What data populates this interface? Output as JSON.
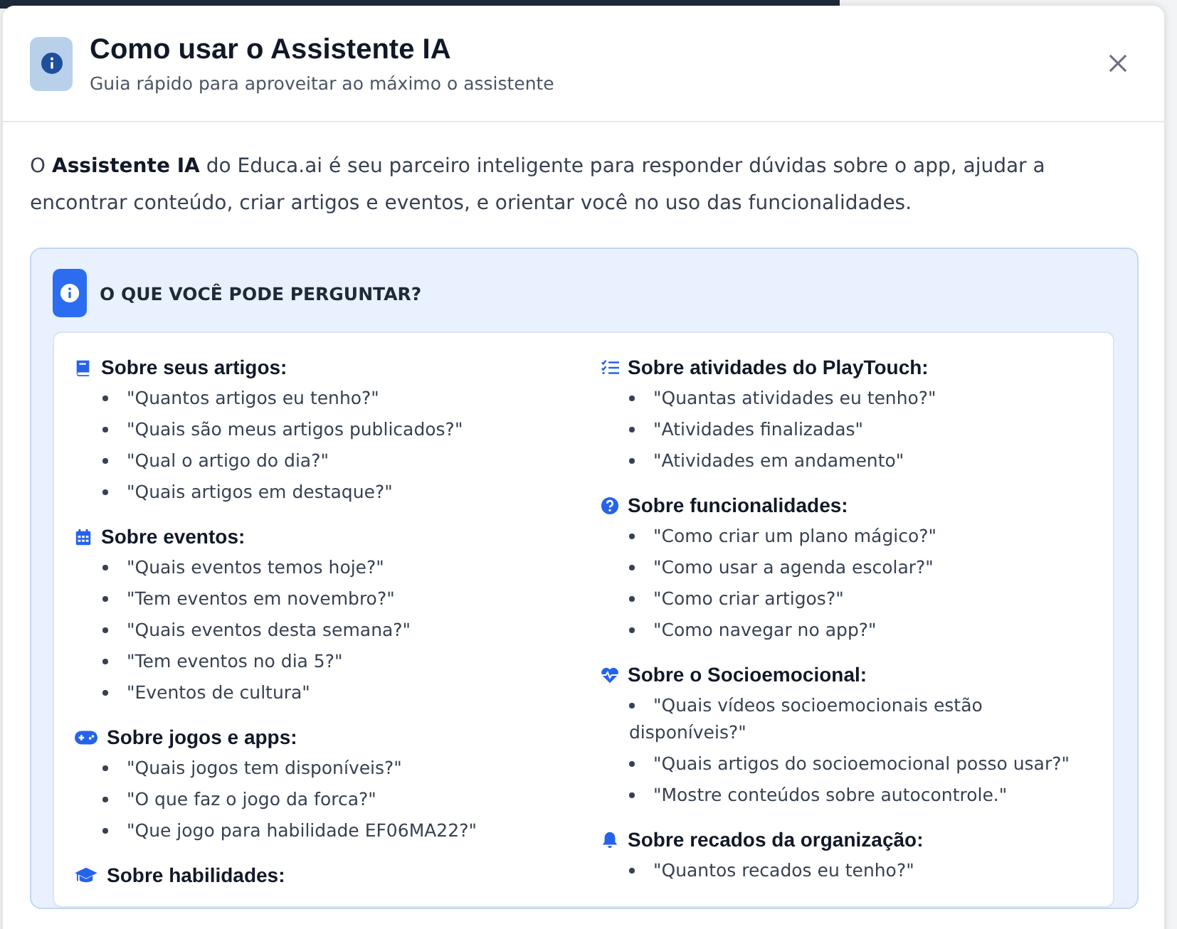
{
  "dialog": {
    "title": "Como usar o Assistente IA",
    "subtitle": "Guia rápido para aproveitar ao máximo o assistente"
  },
  "intro": "O **Assistente IA** do Educa.ai é seu parceiro inteligente para responder dúvidas sobre o app, ajudar a encontrar conteúdo, criar artigos e eventos, e orientar você no uso das funcionalidades.",
  "panel": {
    "title": "O QUE VOCÊ PODE PERGUNTAR?",
    "columns": [
      [
        {
          "kind": "book",
          "title": "Sobre seus artigos:",
          "items": [
            "\"Quantos artigos eu tenho?\"",
            "\"Quais são meus artigos publicados?\"",
            "\"Qual o artigo do dia?\"",
            "\"Quais artigos em destaque?\""
          ]
        },
        {
          "kind": "calendar",
          "title": "Sobre eventos:",
          "items": [
            "\"Quais eventos temos hoje?\"",
            "\"Tem eventos em novembro?\"",
            "\"Quais eventos desta semana?\"",
            "\"Tem eventos no dia 5?\"",
            "\"Eventos de cultura\""
          ]
        },
        {
          "kind": "gamepad",
          "title": "Sobre jogos e apps:",
          "items": [
            "\"Quais jogos tem disponíveis?\"",
            "\"O que faz o jogo da forca?\"",
            "\"Que jogo para habilidade EF06MA22?\""
          ]
        },
        {
          "kind": "graduation",
          "title": "Sobre habilidades:"
        }
      ],
      [
        {
          "kind": "checklist",
          "title": "Sobre atividades do PlayTouch:",
          "items": [
            "\"Quantas atividades eu tenho?\"",
            "\"Atividades finalizadas\"",
            "\"Atividades em andamento\""
          ]
        },
        {
          "kind": "question",
          "title": "Sobre funcionalidades:",
          "items": [
            "\"Como criar um plano mágico?\"",
            "\"Como usar a agenda escolar?\"",
            "\"Como criar artigos?\"",
            "\"Como navegar no app?\""
          ]
        },
        {
          "kind": "heart",
          "title": "Sobre o Socioemocional:",
          "items": [
            "\"Quais vídeos socioemocionais estão disponíveis?\"",
            "\"Quais artigos do socioemocional posso usar?\"",
            "\"Mostre conteúdos sobre autocontrole.\""
          ]
        },
        {
          "kind": "bell",
          "title": "Sobre recados da organização:",
          "items": [
            "\"Quantos recados eu tenho?\""
          ]
        }
      ]
    ]
  }
}
